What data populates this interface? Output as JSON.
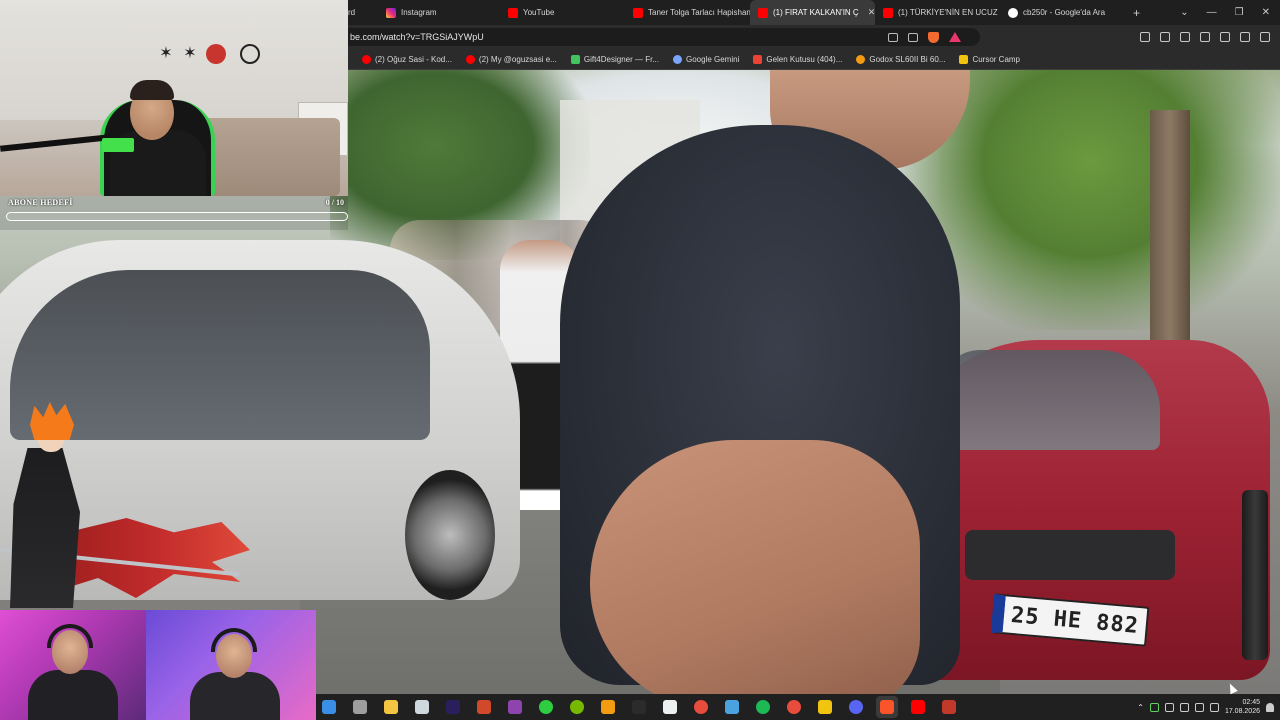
{
  "browser": {
    "tabs": [
      {
        "label": "rd",
        "fav_color": "#ffffff",
        "active": false
      },
      {
        "label": "Instagram",
        "fav_color": "#e1306c",
        "active": false
      },
      {
        "label": "YouTube",
        "fav_color": "#ff0000",
        "active": false
      },
      {
        "label": "Taner Tolga Tarlacı Hapishan",
        "fav_color": "#ff0000",
        "active": false
      },
      {
        "label": "(1) FIRAT KALKAN'IN Ç",
        "fav_color": "#ff0000",
        "active": true
      },
      {
        "label": "(1) TÜRKİYE'NİN EN UCUZ",
        "fav_color": "#ff0000",
        "active": false
      },
      {
        "label": "cb250r - Google'da Ara",
        "fav_color": "#ffffff",
        "active": false
      }
    ],
    "new_tab_label": "+",
    "url": "be.com/watch?v=TRGSiAJYWpU",
    "bookmarks": [
      {
        "label": "(2) Oğuz Sasi - Kod...",
        "color": "#ff0000"
      },
      {
        "label": "(2) My @oguzsasi e...",
        "color": "#ff0000"
      },
      {
        "label": "Gift4Designer — Fr...",
        "color": "#43c463"
      },
      {
        "label": "Google Gemini",
        "color": "#7aa5ff"
      },
      {
        "label": "Gelen Kutusu (404)...",
        "color": "#ea4335"
      },
      {
        "label": "Godox SL60II Bi 60...",
        "color": "#f39c12"
      },
      {
        "label": "Cursor Camp",
        "color": "#f1c40f"
      }
    ]
  },
  "overlay": {
    "sub_goal_label": "ABONE HEDEFİ",
    "sub_goal_count": "0 / 10",
    "sub_goal_progress": 0.0
  },
  "video": {
    "plate_text": "25 HE 882"
  },
  "taskbar": {
    "icons": [
      {
        "name": "windows-icon",
        "color": "#3a8ee6"
      },
      {
        "name": "calculator-icon",
        "color": "#9e9e9e"
      },
      {
        "name": "notepad-icon",
        "color": "#f4c542"
      },
      {
        "name": "terminal-icon",
        "color": "#cfd8dc"
      },
      {
        "name": "premiere-icon",
        "color": "#2a1f5c"
      },
      {
        "name": "game-icon",
        "color": "#d0492a"
      },
      {
        "name": "app-icon",
        "color": "#8e44ad"
      },
      {
        "name": "xbox-icon",
        "color": "#2ecc40"
      },
      {
        "name": "nvidia-icon",
        "color": "#76b900"
      },
      {
        "name": "cloud-icon",
        "color": "#f39c12"
      },
      {
        "name": "epic-icon",
        "color": "#2b2b2b"
      },
      {
        "name": "clapper-icon",
        "color": "#ecf0f1"
      },
      {
        "name": "record-icon",
        "color": "#e74c3c"
      },
      {
        "name": "steam-icon",
        "color": "#4aa3df"
      },
      {
        "name": "spotify-icon",
        "color": "#1db954"
      },
      {
        "name": "chrome-icon",
        "color": "#e74c3c"
      },
      {
        "name": "folder-icon",
        "color": "#f1c40f"
      },
      {
        "name": "discord-icon",
        "color": "#5865f2"
      },
      {
        "name": "brave-icon",
        "color": "#fb542b"
      },
      {
        "name": "youtube-icon",
        "color": "#ff0000"
      },
      {
        "name": "app2-icon",
        "color": "#c0392b"
      }
    ],
    "time": "02:45",
    "date": "17.08.2026"
  }
}
